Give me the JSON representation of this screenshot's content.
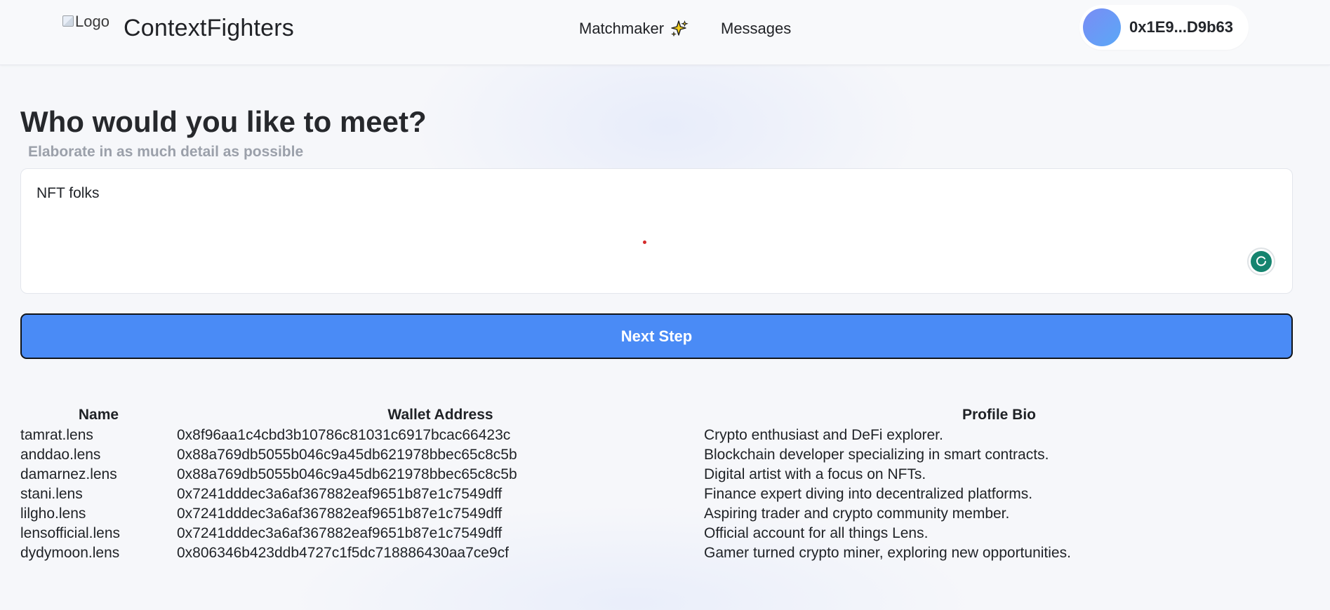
{
  "header": {
    "logo_alt": "Logo",
    "brand": "ContextFighters",
    "nav": {
      "matchmaker": "Matchmaker",
      "messages": "Messages"
    },
    "wallet": "0x1E9...D9b63"
  },
  "main": {
    "title": "Who would you like to meet?",
    "subtitle": "Elaborate in as much detail as possible",
    "input_value": "NFT folks",
    "next_label": "Next Step"
  },
  "table": {
    "headers": [
      "Name",
      "Wallet Address",
      "Profile Bio"
    ],
    "rows": [
      {
        "name": "tamrat.lens",
        "wallet": "0x8f96aa1c4cbd3b10786c81031c6917bcac66423c",
        "bio": "Crypto enthusiast and DeFi explorer."
      },
      {
        "name": "anddao.lens",
        "wallet": "0x88a769db5055b046c9a45db621978bbec65c8c5b",
        "bio": "Blockchain developer specializing in smart contracts."
      },
      {
        "name": "damarnez.lens",
        "wallet": "0x88a769db5055b046c9a45db621978bbec65c8c5b",
        "bio": "Digital artist with a focus on NFTs."
      },
      {
        "name": "stani.lens",
        "wallet": "0x7241dddec3a6af367882eaf9651b87e1c7549dff",
        "bio": "Finance expert diving into decentralized platforms."
      },
      {
        "name": "lilgho.lens",
        "wallet": "0x7241dddec3a6af367882eaf9651b87e1c7549dff",
        "bio": "Aspiring trader and crypto community member."
      },
      {
        "name": "lensofficial.lens",
        "wallet": "0x7241dddec3a6af367882eaf9651b87e1c7549dff",
        "bio": "Official account for all things Lens."
      },
      {
        "name": "dydymoon.lens",
        "wallet": "0x806346b423ddb4727c1f5dc718886430aa7ce9cf",
        "bio": "Gamer turned crypto miner, exploring new opportunities."
      }
    ]
  },
  "icons": {
    "sparkle": "sparkle-icon",
    "grammar": "grammar-assistant-icon"
  },
  "colors": {
    "primary_button": "#4a8bf6",
    "avatar_start": "#7a8cf5",
    "avatar_end": "#5aa8f6",
    "grammar": "#15846f"
  }
}
